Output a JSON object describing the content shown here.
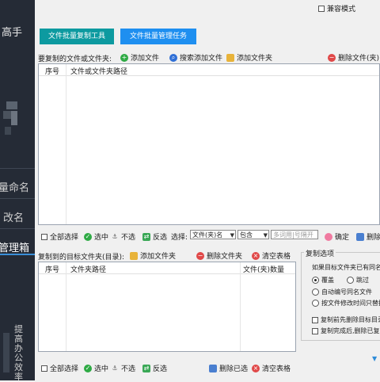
{
  "topbar": {
    "compat_mode_label": "兼容模式"
  },
  "sidebar": {
    "brand_fragment": "高手",
    "items": [
      {
        "label": "量命名"
      },
      {
        "label": "改名"
      },
      {
        "label": "管理箱"
      }
    ],
    "bottom_slogan": "提高办公效率"
  },
  "tabs": [
    {
      "label": "文件批量复制工具"
    },
    {
      "label": "文件批量管理任务"
    }
  ],
  "source_section": {
    "title": "要复制的文件或文件夹:",
    "add_file": "添加文件",
    "search_add_file": "搜索添加文件",
    "add_folder": "添加文件夹",
    "delete_files": "删除文件(夹)",
    "col_index": "序号",
    "col_path": "文件或文件夹路径"
  },
  "source_toolbar": {
    "select_all": "全部选择",
    "select": "选中",
    "deselect": "不选",
    "invert": "反选",
    "choose_label": "选择:",
    "field_value": "文件(夹)名",
    "match_value": "包含",
    "keyword_placeholder": "多词用|号隔开",
    "confirm": "确定",
    "delete_trunc": "删除"
  },
  "target_section": {
    "title": "复制到的目标文件夹(目录):",
    "add_folder": "添加文件夹",
    "delete_folder": "删除文件夹",
    "clear_table": "清空表格",
    "col_index": "序号",
    "col_path": "文件夹路径",
    "col_count": "文件(夹)数量"
  },
  "target_toolbar": {
    "select_all": "全部选择",
    "select": "选中",
    "deselect": "不选",
    "invert": "反选",
    "delete_selected": "删除已选",
    "clear_table": "清空表格"
  },
  "copy_options": {
    "title": "复制选项",
    "same_name_label": "如果目标文件夹已有同名文",
    "overwrite": "覆盖",
    "skip": "跳过",
    "auto_number": "自动编号同名文件",
    "replace_by_time": "按文件修改时间只替换",
    "delete_target_first": "复制前先删除目标目录",
    "delete_source_after": "复制完成后,删除已复"
  },
  "colors": {
    "sidebar": "#252b36",
    "tab_active": "#0d9aa0",
    "tab_other": "#1e8ff0"
  }
}
